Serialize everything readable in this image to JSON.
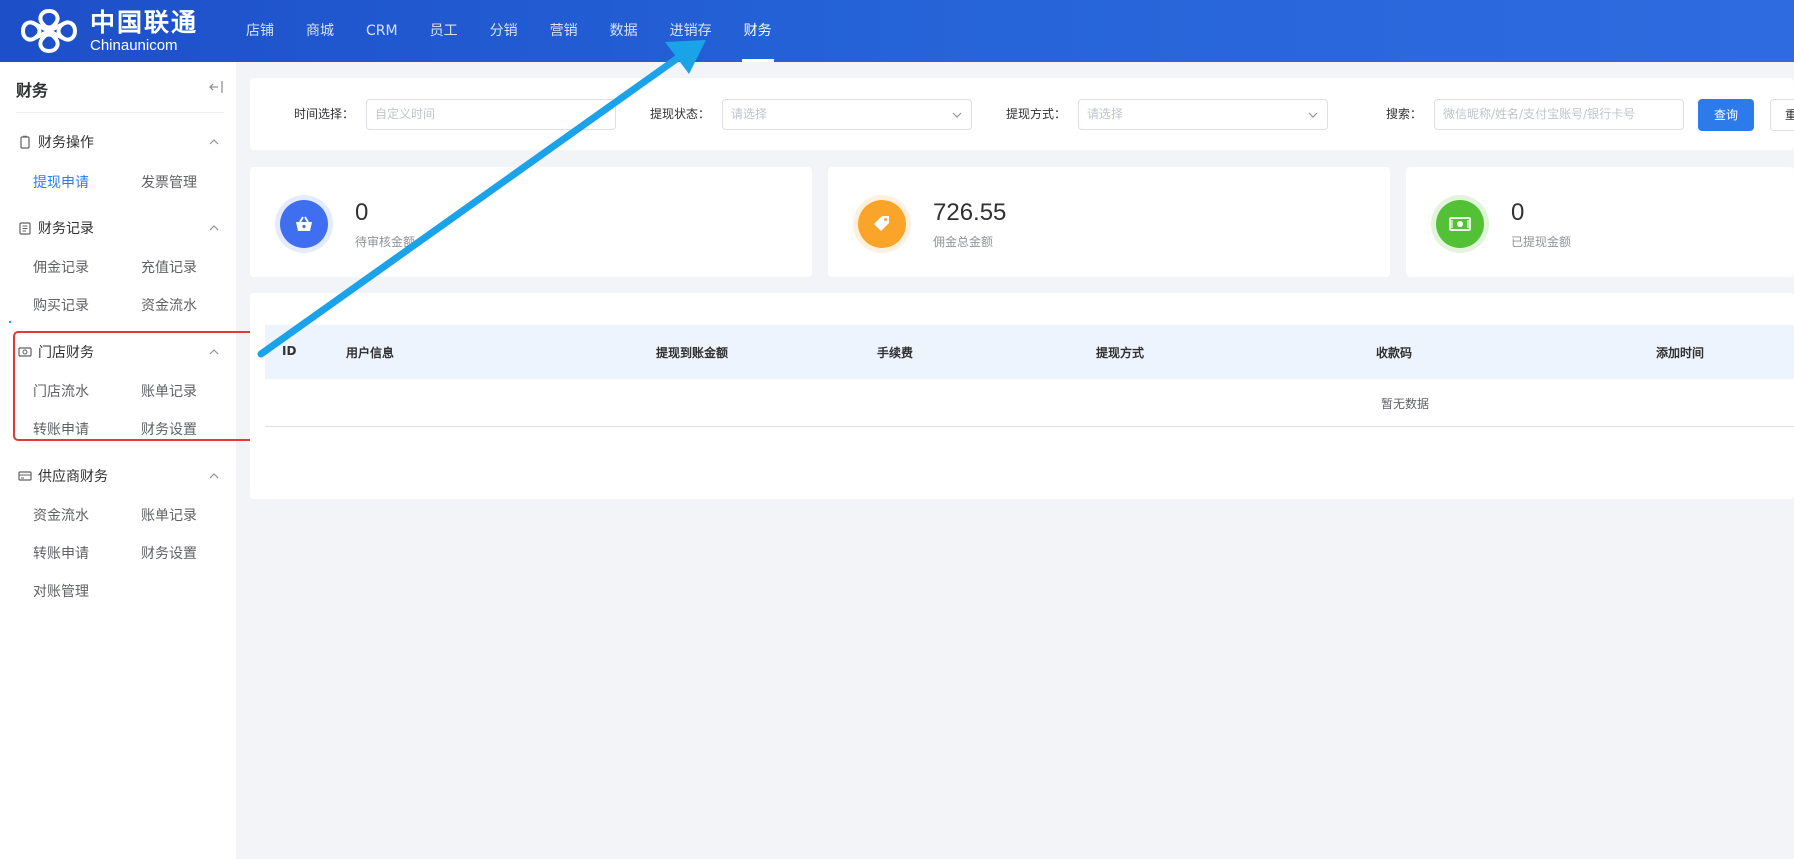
{
  "header": {
    "logo_cn": "中国联通",
    "logo_en": "Chinaunicom",
    "nav": [
      "店铺",
      "商城",
      "CRM",
      "员工",
      "分销",
      "营销",
      "数据",
      "进销存",
      "财务"
    ],
    "active_nav": "财务"
  },
  "sidebar": {
    "title": "财务",
    "groups": [
      {
        "label": "财务操作",
        "icon": "clipboard-icon",
        "items": [
          "提现申请",
          "发票管理"
        ]
      },
      {
        "label": "财务记录",
        "icon": "ledger-icon",
        "items": [
          "佣金记录",
          "充值记录",
          "购买记录",
          "资金流水"
        ]
      },
      {
        "label": "门店财务",
        "icon": "store-money-icon",
        "items": [
          "门店流水",
          "账单记录",
          "转账申请",
          "财务设置"
        ]
      },
      {
        "label": "供应商财务",
        "icon": "card-icon",
        "items": [
          "资金流水",
          "账单记录",
          "转账申请",
          "财务设置",
          "对账管理"
        ]
      }
    ],
    "active_item": "提现申请"
  },
  "filter": {
    "time_label": "时间选择：",
    "time_placeholder": "自定义时间",
    "status_label": "提现状态：",
    "status_placeholder": "请选择",
    "method_label": "提现方式：",
    "method_placeholder": "请选择",
    "search_label": "搜索：",
    "search_placeholder": "微信昵称/姓名/支付宝账号/银行卡号",
    "query_button": "查询",
    "reset_button": "重置"
  },
  "stats": [
    {
      "value": "0",
      "label": "待审核金额",
      "icon": "basket-icon",
      "color": "#3f6ff0"
    },
    {
      "value": "726.55",
      "label": "佣金总金额",
      "icon": "tag-icon",
      "color": "#fba42a"
    },
    {
      "value": "0",
      "label": "已提现金额",
      "icon": "cash-icon",
      "color": "#53c136"
    }
  ],
  "table": {
    "columns": [
      "ID",
      "用户信息",
      "提现到账金额",
      "手续费",
      "提现方式",
      "收款码",
      "添加时间"
    ],
    "empty_text": "暂无数据"
  },
  "colors": {
    "header": "#2563d8",
    "accent": "#2d7bea",
    "annotation_arrow": "#1aa3e8",
    "annotation_box": "#e53935"
  }
}
